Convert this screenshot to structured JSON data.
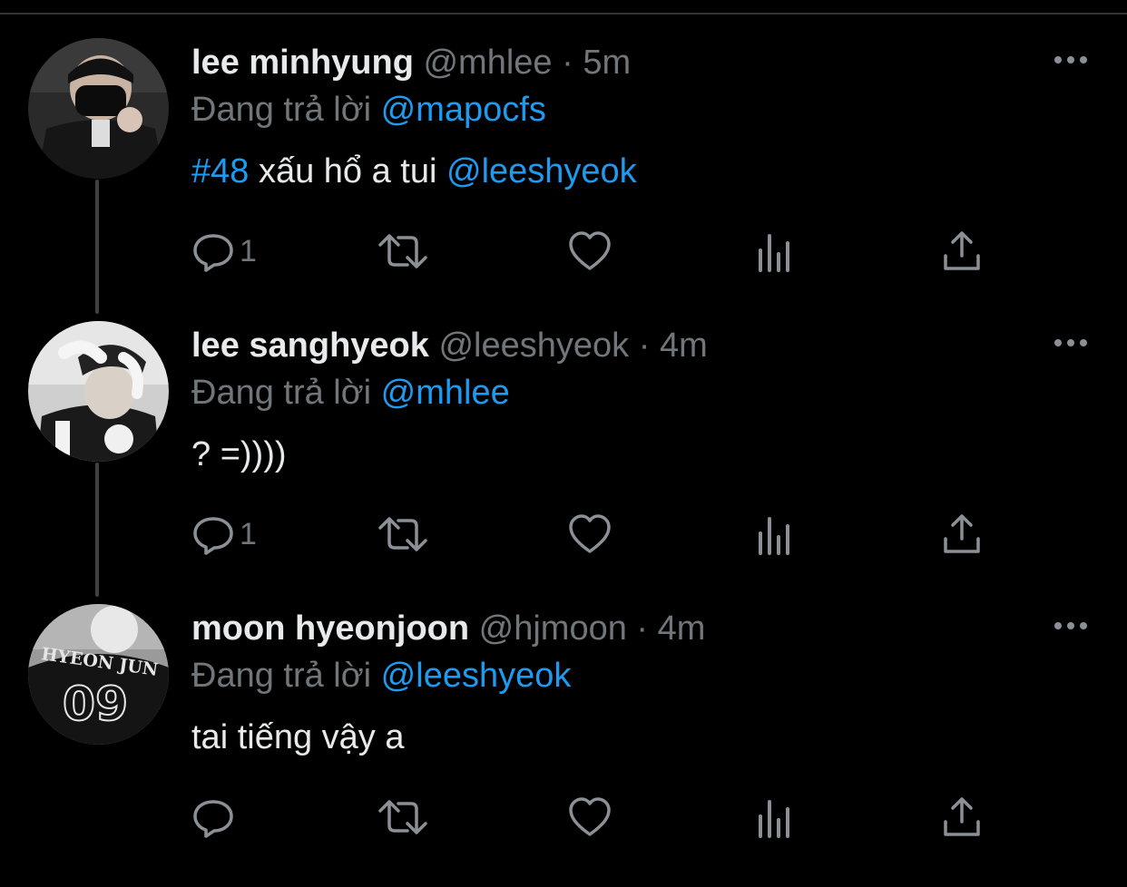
{
  "colors": {
    "background": "#000000",
    "name": "#e7e9ea",
    "muted": "#71767b",
    "link": "#1d9bf0"
  },
  "tweets": [
    {
      "avatar_icon": "user-avatar-mask",
      "name": "lee minhyung",
      "handle": "@mhlee",
      "sep": "·",
      "time": "5m",
      "reply_prefix": "Đang trả lời",
      "reply_to": "@mapocfs",
      "text_parts": [
        {
          "text": "#48",
          "link": true
        },
        {
          "text": " xấu hổ a tui ",
          "link": false
        },
        {
          "text": "@leeshyeok",
          "link": true
        }
      ],
      "reply_count": "1"
    },
    {
      "avatar_icon": "user-avatar-cap",
      "name": "lee sanghyeok",
      "handle": "@leeshyeok",
      "sep": "·",
      "time": "4m",
      "reply_prefix": "Đang trả lời",
      "reply_to": "@mhlee",
      "text_parts": [
        {
          "text": "? =))))",
          "link": false
        }
      ],
      "reply_count": "1"
    },
    {
      "avatar_icon": "user-avatar-jersey",
      "name": "moon hyeonjoon",
      "handle": "@hjmoon",
      "sep": "·",
      "time": "4m",
      "reply_prefix": "Đang trả lời",
      "reply_to": "@leeshyeok",
      "text_parts": [
        {
          "text": "tai tiếng vậy a",
          "link": false
        }
      ],
      "reply_count": ""
    }
  ],
  "jersey": {
    "line1": "HYEON JUN",
    "number": "09"
  },
  "icons": [
    "more-icon",
    "reply-icon",
    "retweet-icon",
    "like-icon",
    "views-icon",
    "share-icon"
  ]
}
